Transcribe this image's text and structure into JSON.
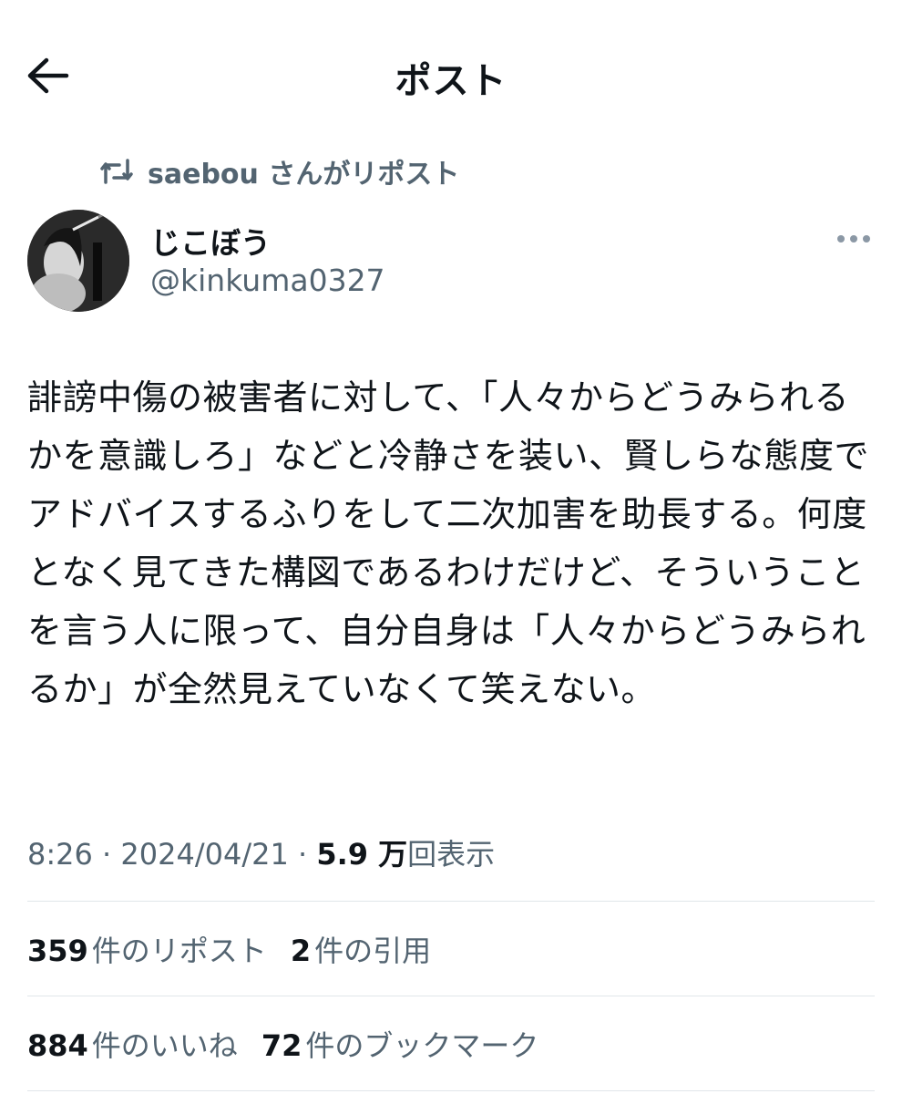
{
  "header": {
    "title": "ポスト",
    "back_icon": "arrow-left-icon"
  },
  "repost": {
    "icon": "repost-icon",
    "text": "saebou さんがリポスト"
  },
  "author": {
    "display_name": "じこぼう",
    "handle": "@kinkuma0327"
  },
  "post": {
    "text": "誹謗中傷の被害者に対して、「人々からどうみられるかを意識しろ」などと冷静さを装い、賢しらな態度でアドバイスするふりをして二次加害を助長する。何度となく見てきた構図であるわけだけど、そういうことを言う人に限って、自分自身は「人々からどうみられるか」が全然見えていなくて笑えない。"
  },
  "meta": {
    "time": "8:26",
    "sep1": " · ",
    "date": "2024/04/21",
    "sep2": " · ",
    "views_num": "5.9 万",
    "views_label": "回表示"
  },
  "stats": {
    "reposts_num": "359",
    "reposts_label": "件のリポスト",
    "quotes_num": "2",
    "quotes_label": "件の引用",
    "likes_num": "884",
    "likes_label": "件のいいね",
    "bookmarks_num": "72",
    "bookmarks_label": "件のブックマーク"
  },
  "colors": {
    "text": "#0f1419",
    "secondary": "#536471",
    "divider": "#e1e6ea",
    "background": "#ffffff"
  }
}
